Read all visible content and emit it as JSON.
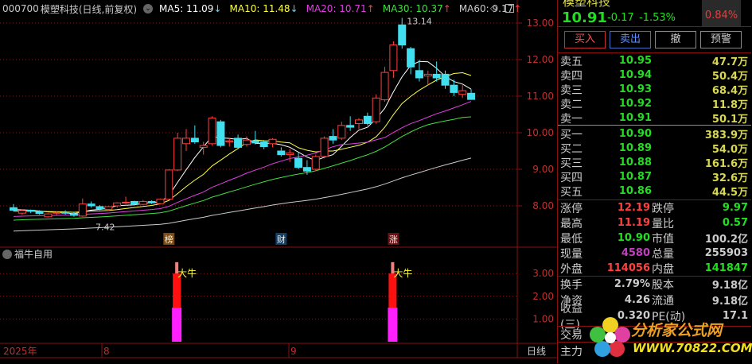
{
  "header": {
    "code": "000700",
    "name": "模塑科技",
    "mode": "(日线,前复权)",
    "ma": [
      {
        "label": "MA5: 11.09",
        "arrow": "↓",
        "color": "#ffffff"
      },
      {
        "label": "MA10: 11.48",
        "arrow": "↓",
        "color": "#ffff40"
      },
      {
        "label": "MA20: 10.71",
        "arrow": "↑",
        "color": "#e040e0"
      },
      {
        "label": "MA30: 10.37",
        "arrow": "↑",
        "color": "#40e040"
      },
      {
        "label": "MA60: 9.17",
        "arrow": "↑",
        "color": "#cccccc"
      }
    ]
  },
  "annotations": {
    "high": "13.14",
    "low": "7.42"
  },
  "markers": [
    {
      "text": "榜",
      "bg": "#7a4a10"
    },
    {
      "text": "财",
      "bg": "#10406a"
    },
    {
      "text": "涨",
      "bg": "#6a1010"
    }
  ],
  "sub": {
    "title": "福牛自用",
    "signal": "大牛",
    "ticks": [
      "3.00",
      "2.00",
      "1.00"
    ]
  },
  "time_axis": {
    "year": "2025年",
    "months": [
      "8",
      "9"
    ],
    "period": "日线"
  },
  "chart_data": {
    "type": "candlestick",
    "ylim": [
      7.3,
      13.3
    ],
    "y_ticks": [
      "13.00",
      "12.00",
      "11.00",
      "10.00",
      "9.00",
      "8.00"
    ],
    "candles": [
      [
        7.95,
        8.05,
        7.85,
        7.88
      ],
      [
        7.8,
        7.9,
        7.75,
        7.87
      ],
      [
        7.88,
        7.9,
        7.8,
        7.85
      ],
      [
        7.85,
        7.88,
        7.76,
        7.79
      ],
      [
        7.7,
        7.8,
        7.68,
        7.78
      ],
      [
        7.8,
        7.85,
        7.74,
        7.82
      ],
      [
        7.82,
        7.88,
        7.76,
        7.8
      ],
      [
        7.78,
        7.84,
        7.7,
        7.74
      ],
      [
        7.72,
        8.2,
        7.7,
        8.05
      ],
      [
        8.05,
        8.12,
        7.95,
        8.0
      ],
      [
        7.98,
        8.02,
        7.88,
        7.92
      ],
      [
        7.9,
        8.0,
        7.86,
        7.98
      ],
      [
        8.0,
        8.1,
        7.95,
        8.08
      ],
      [
        8.1,
        8.25,
        8.05,
        8.1
      ],
      [
        8.12,
        8.14,
        8.02,
        8.05
      ],
      [
        8.04,
        8.16,
        8.02,
        8.12
      ],
      [
        8.12,
        8.15,
        8.05,
        8.08
      ],
      [
        8.06,
        8.2,
        8.04,
        8.18
      ],
      [
        8.18,
        9.0,
        8.16,
        8.98
      ],
      [
        8.98,
        10.0,
        8.95,
        9.85
      ],
      [
        9.7,
        10.1,
        9.5,
        9.85
      ],
      [
        9.85,
        10.2,
        9.7,
        9.75
      ],
      [
        9.6,
        9.75,
        9.4,
        9.65
      ],
      [
        9.7,
        10.45,
        9.65,
        10.4
      ],
      [
        10.3,
        10.35,
        9.6,
        9.65
      ],
      [
        9.75,
        9.85,
        9.62,
        9.78
      ],
      [
        9.85,
        9.95,
        9.55,
        9.6
      ],
      [
        9.68,
        9.9,
        9.62,
        9.8
      ],
      [
        9.78,
        10.05,
        9.68,
        9.72
      ],
      [
        9.75,
        9.8,
        9.55,
        9.62
      ],
      [
        9.7,
        9.85,
        9.6,
        9.82
      ],
      [
        9.5,
        9.6,
        9.35,
        9.4
      ],
      [
        9.4,
        9.55,
        9.2,
        9.45
      ],
      [
        9.3,
        9.45,
        9.0,
        9.05
      ],
      [
        9.05,
        9.25,
        8.85,
        8.95
      ],
      [
        9.0,
        9.4,
        8.95,
        9.35
      ],
      [
        9.35,
        9.9,
        9.3,
        9.85
      ],
      [
        9.9,
        10.1,
        9.7,
        9.8
      ],
      [
        9.85,
        10.3,
        9.8,
        10.2
      ],
      [
        10.2,
        10.45,
        10.05,
        10.15
      ],
      [
        10.25,
        10.4,
        10.1,
        10.35
      ],
      [
        10.45,
        10.55,
        10.2,
        10.25
      ],
      [
        10.3,
        11.05,
        10.25,
        10.95
      ],
      [
        10.9,
        11.8,
        10.85,
        11.65
      ],
      [
        11.7,
        12.5,
        11.5,
        12.4
      ],
      [
        12.95,
        13.14,
        12.3,
        12.4
      ],
      [
        12.3,
        12.35,
        11.6,
        11.8
      ],
      [
        11.7,
        12.0,
        11.4,
        11.5
      ],
      [
        11.55,
        11.7,
        11.3,
        11.6
      ],
      [
        11.6,
        11.95,
        11.4,
        11.5
      ],
      [
        11.6,
        11.7,
        11.2,
        11.3
      ],
      [
        11.3,
        11.45,
        11.0,
        11.1
      ],
      [
        11.05,
        11.3,
        10.95,
        11.15
      ],
      [
        11.08,
        11.19,
        10.9,
        10.91
      ]
    ],
    "signals": [
      {
        "index": 19,
        "segments": [
          1.5,
          3.0,
          3.5
        ]
      },
      {
        "index": 44,
        "segments": [
          1.5,
          3.0,
          3.5
        ]
      }
    ],
    "sub_ylim": [
      0,
      3.8
    ]
  },
  "quote": {
    "title": "模塑科技",
    "price": "10.91",
    "change": "-0.17",
    "pct": "-1.53%",
    "box": "0.84%"
  },
  "buttons": [
    "买入",
    "卖出",
    "撤",
    "预警"
  ],
  "asks": [
    {
      "l": "卖五",
      "p": "10.95",
      "v": "47.7万"
    },
    {
      "l": "卖四",
      "p": "10.94",
      "v": "50.4万"
    },
    {
      "l": "卖三",
      "p": "10.93",
      "v": "68.4万"
    },
    {
      "l": "卖二",
      "p": "10.92",
      "v": "11.8万"
    },
    {
      "l": "卖一",
      "p": "10.91",
      "v": "50.1万"
    }
  ],
  "bids": [
    {
      "l": "买一",
      "p": "10.90",
      "v": "383.9万"
    },
    {
      "l": "买二",
      "p": "10.89",
      "v": "54.0万"
    },
    {
      "l": "买三",
      "p": "10.88",
      "v": "161.6万"
    },
    {
      "l": "买四",
      "p": "10.87",
      "v": "32.6万"
    },
    {
      "l": "买五",
      "p": "10.86",
      "v": "44.5万"
    }
  ],
  "stats": [
    {
      "l1": "涨停",
      "v1": "12.19",
      "c1": "#ff4040",
      "l2": "跌停",
      "v2": "9.97",
      "c2": "#22dd22"
    },
    {
      "l1": "最高",
      "v1": "11.19",
      "c1": "#ff4040",
      "l2": "量比",
      "v2": "0.57",
      "c2": "#22dd22"
    },
    {
      "l1": "最低",
      "v1": "10.90",
      "c1": "#22dd22",
      "l2": "市值",
      "v2": "100.2亿",
      "c2": "#ccc"
    },
    {
      "l1": "现量",
      "v1": "4580",
      "c1": "#c040c0",
      "l2": "总量",
      "v2": "255903",
      "c2": "#ccc"
    },
    {
      "l1": "外盘",
      "v1": "114056",
      "c1": "#ff4040",
      "l2": "内盘",
      "v2": "141847",
      "c2": "#22dd22"
    }
  ],
  "stats2": [
    {
      "l1": "换手",
      "v1": "2.79%",
      "l2": "股本",
      "v2": "9.18亿"
    },
    {
      "l1": "净资",
      "v1": "4.26",
      "l2": "流通",
      "v2": "9.18亿"
    },
    {
      "l1": "收益(三)",
      "v1": "0.320",
      "l2": "PE(动)",
      "v2": "17.1"
    }
  ],
  "bottom_rows": [
    "交易",
    "主力"
  ],
  "watermark": {
    "name": "分析家公式网",
    "url": "WWW.70822.COM"
  }
}
